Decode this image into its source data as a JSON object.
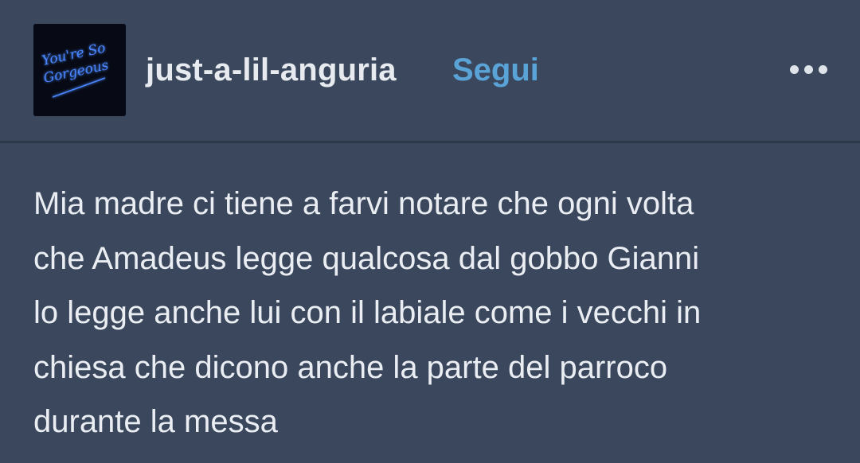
{
  "post": {
    "author": {
      "username": "just-a-lil-anguria",
      "avatar_icon": "neon-sign-avatar",
      "avatar_text": "You're So Gorgeous"
    },
    "follow_label": "Segui",
    "more_icon": "ellipsis-icon",
    "body_text": "Mia madre ci tiene a farvi notare che ogni volta\nche Amadeus legge qualcosa dal gobbo Gianni\nlo legge anche lui con il labiale come i vecchi in\nchiesa che dicono anche la parte del parroco\ndurante la messa"
  },
  "colors": {
    "background": "#3a475c",
    "text": "#eaeef3",
    "accent": "#5aa3d6",
    "avatar_bg": "#070a14",
    "neon": "#3d7bff"
  }
}
